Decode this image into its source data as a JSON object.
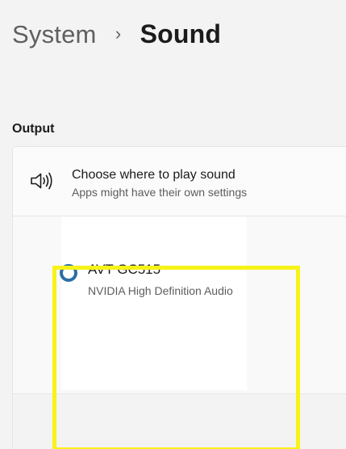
{
  "breadcrumb": {
    "parent": "System",
    "separator": "›",
    "current": "Sound"
  },
  "output": {
    "section_title": "Output",
    "row_title": "Choose where to play sound",
    "row_subtitle": "Apps might have their own settings",
    "icon": "speaker-icon"
  },
  "device": {
    "name": "AVT GC515",
    "description": "NVIDIA High Definition Audio",
    "selected": false,
    "radio_color": "#2c6ea7"
  },
  "highlight": {
    "color": "#f7f318"
  }
}
